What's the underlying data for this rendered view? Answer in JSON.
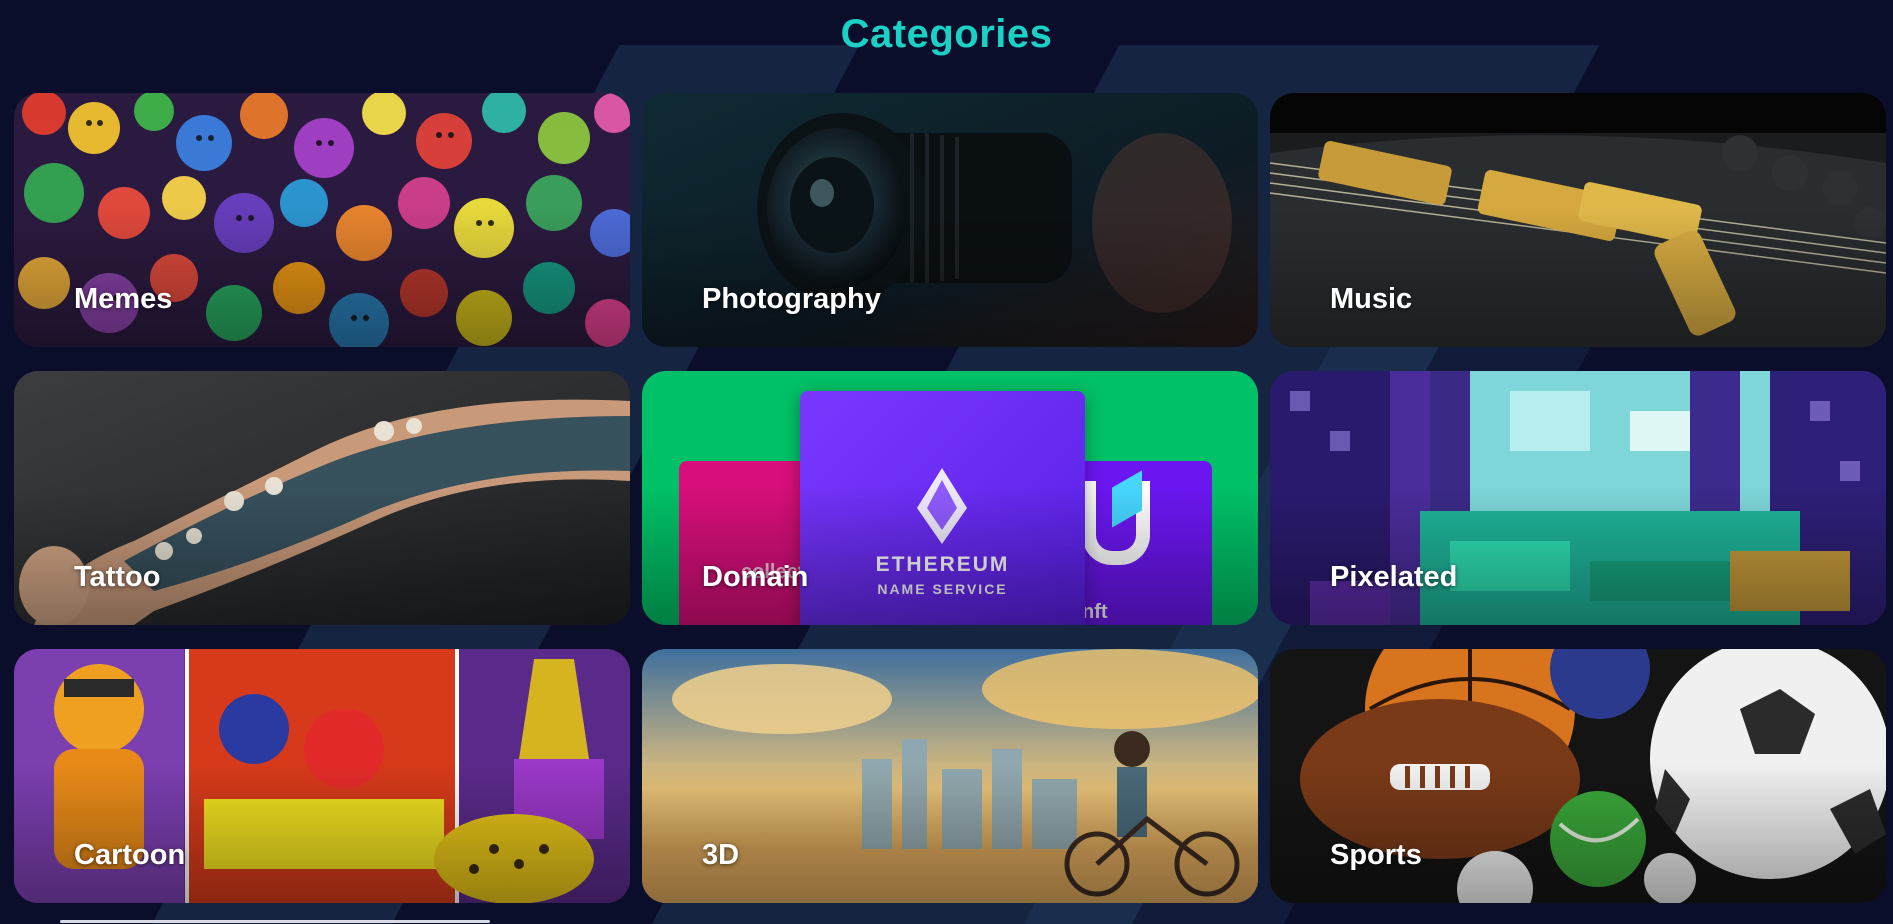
{
  "header": {
    "title": "Categories"
  },
  "categories": [
    {
      "label": "Memes"
    },
    {
      "label": "Photography"
    },
    {
      "label": "Music"
    },
    {
      "label": "Tattoo"
    },
    {
      "label": "Domain"
    },
    {
      "label": "Pixelated"
    },
    {
      "label": "Cartoon"
    },
    {
      "label": "3D"
    },
    {
      "label": "Sports"
    }
  ],
  "domain_art": {
    "ens_line1": "ETHEREUM",
    "ens_line2": "NAME SERVICE",
    "left_card_text": "collect",
    "right_card_text": "nft"
  },
  "colors": {
    "background": "#0b0e2a",
    "title": "#1ad1c6",
    "domain_green": "#00c167",
    "ens_purple": "#6f2cf6"
  }
}
